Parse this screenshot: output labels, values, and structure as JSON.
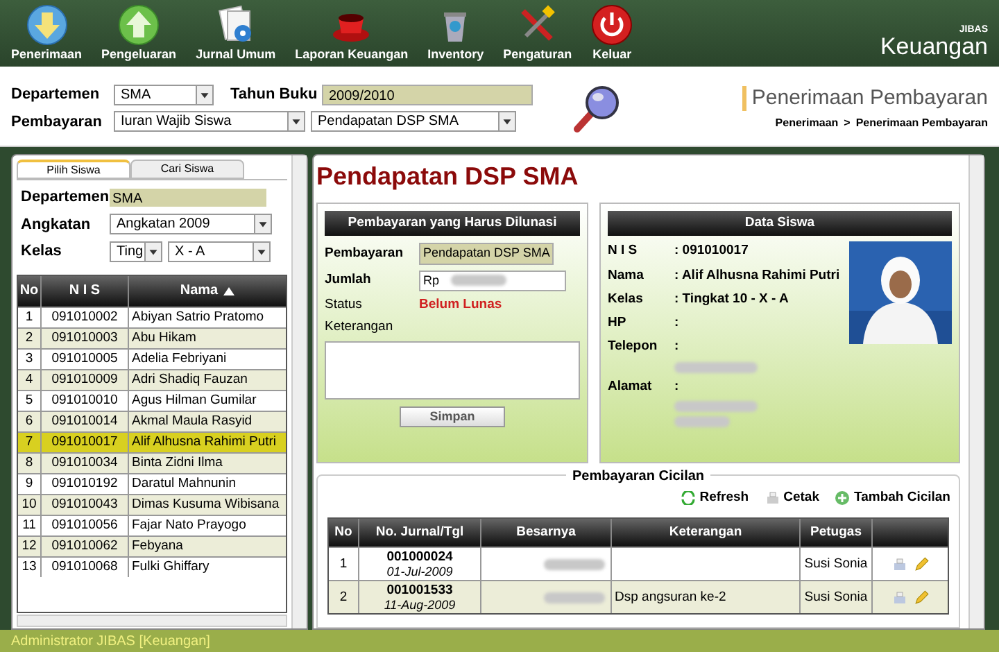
{
  "toolbar": {
    "items": [
      {
        "label": "Penerimaan"
      },
      {
        "label": "Pengeluaran"
      },
      {
        "label": "Jurnal Umum"
      },
      {
        "label": "Laporan Keuangan"
      },
      {
        "label": "Inventory"
      },
      {
        "label": "Pengaturan"
      },
      {
        "label": "Keluar"
      }
    ],
    "logo_small": "JIBAS",
    "logo": "Keuangan"
  },
  "filter": {
    "departemen_label": "Departemen",
    "departemen": "SMA",
    "tahun_label": "Tahun Buku",
    "tahun": "2009/2010",
    "pembayaran_label": "Pembayaran",
    "pembayaran": "Iuran Wajib Siswa",
    "jenis": "Pendapatan DSP SMA"
  },
  "page_title": "Penerimaan Pembayaran",
  "breadcrumb": [
    "Penerimaan",
    ">",
    "Penerimaan Pembayaran"
  ],
  "left": {
    "tabs": [
      {
        "label": "Pilih Siswa",
        "selected": true
      },
      {
        "label": "Cari Siswa",
        "selected": false
      }
    ],
    "departemen_label": "Departemen",
    "departemen": "SMA",
    "angkatan_label": "Angkatan",
    "angkatan": "Angkatan 2009",
    "kelas_label": "Kelas",
    "tingkat": "Ting",
    "kelas": "X - A",
    "columns": [
      "No",
      "N I S",
      "Nama"
    ],
    "rows": [
      {
        "no": "1",
        "nis": "091010002",
        "nama": "Abiyan Satrio Pratomo",
        "selected": false
      },
      {
        "no": "2",
        "nis": "091010003",
        "nama": "Abu Hikam",
        "selected": false
      },
      {
        "no": "3",
        "nis": "091010005",
        "nama": "Adelia Febriyani",
        "selected": false
      },
      {
        "no": "4",
        "nis": "091010009",
        "nama": "Adri Shadiq Fauzan",
        "selected": false
      },
      {
        "no": "5",
        "nis": "091010010",
        "nama": "Agus Hilman Gumilar",
        "selected": false
      },
      {
        "no": "6",
        "nis": "091010014",
        "nama": "Akmal Maula Rasyid",
        "selected": false
      },
      {
        "no": "7",
        "nis": "091010017",
        "nama": "Alif Alhusna Rahimi Putri",
        "selected": true
      },
      {
        "no": "8",
        "nis": "091010034",
        "nama": "Binta Zidni Ilma",
        "selected": false
      },
      {
        "no": "9",
        "nis": "091010192",
        "nama": "Daratul Mahnunin",
        "selected": false
      },
      {
        "no": "10",
        "nis": "091010043",
        "nama": "Dimas Kusuma Wibisana",
        "selected": false
      },
      {
        "no": "11",
        "nis": "091010056",
        "nama": "Fajar Nato Prayogo",
        "selected": false
      },
      {
        "no": "12",
        "nis": "091010062",
        "nama": "Febyana",
        "selected": false
      },
      {
        "no": "13",
        "nis": "091010068",
        "nama": "Fulki Ghiffary",
        "selected": false
      }
    ]
  },
  "heading": "Pendapatan DSP SMA",
  "payment": {
    "title": "Pembayaran yang Harus Dilunasi",
    "pembayaran_label": "Pembayaran",
    "pembayaran": "Pendapatan DSP SMA",
    "jumlah_label": "Jumlah",
    "currency": "Rp",
    "status_label": "Status",
    "status": "Belum Lunas",
    "keterangan_label": "Keterangan",
    "save": "Simpan"
  },
  "student": {
    "title": "Data Siswa",
    "fields": [
      {
        "label": "N I S",
        "value": ": 091010017"
      },
      {
        "label": "Nama",
        "value": ": Alif Alhusna Rahimi Putri"
      },
      {
        "label": "Kelas",
        "value": ": Tingkat 10 - X - A"
      },
      {
        "label": "HP",
        "value": ":"
      },
      {
        "label": "Telepon",
        "value": ":"
      },
      {
        "label": "Alamat",
        "value": ":"
      }
    ]
  },
  "installments": {
    "title": "Pembayaran Cicilan",
    "actions": [
      "Refresh",
      "Cetak",
      "Tambah Cicilan"
    ],
    "columns": [
      "No",
      "No. Jurnal/Tgl",
      "Besarnya",
      "Keterangan",
      "Petugas"
    ],
    "rows": [
      {
        "no": "1",
        "jurnal": "001000024",
        "tgl": "01-Jul-2009",
        "keterangan": "",
        "petugas": "Susi Sonia"
      },
      {
        "no": "2",
        "jurnal": "001001533",
        "tgl": "11-Aug-2009",
        "keterangan": "Dsp angsuran ke-2",
        "petugas": "Susi Sonia"
      }
    ]
  },
  "status_bar": "Administrator JIBAS [Keuangan]"
}
